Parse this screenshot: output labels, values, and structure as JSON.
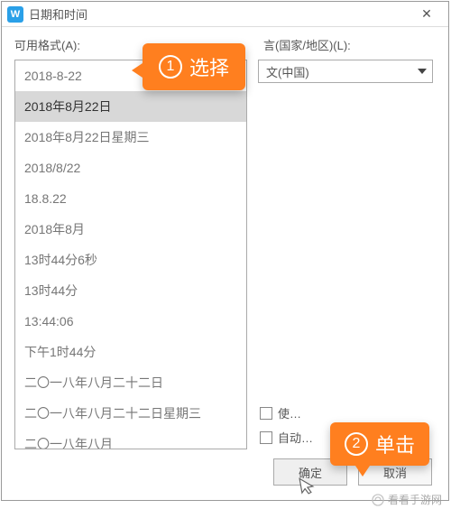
{
  "titlebar": {
    "icon_letter": "W",
    "title": "日期和时间",
    "close": "✕"
  },
  "labels": {
    "format": "可用格式(A):",
    "locale": "言(国家/地区)(L):"
  },
  "locale": {
    "selected": "文(中国)"
  },
  "formats": [
    "2018-8-22",
    "2018年8月22日",
    "2018年8月22日星期三",
    "2018/8/22",
    "18.8.22",
    "2018年8月",
    "13时44分6秒",
    "13时44分",
    "13:44:06",
    "下午1时44分",
    "二〇一八年八月二十二日",
    "二〇一八年八月二十二日星期三",
    "二〇一八年八月"
  ],
  "selected_index": 1,
  "checkboxes": {
    "use": "使…",
    "auto": "自动…"
  },
  "buttons": {
    "ok": "确定",
    "cancel": "取消"
  },
  "callouts": {
    "one_num": "1",
    "one_text": "选择",
    "two_num": "2",
    "two_text": "单击"
  },
  "watermark": "看看手游网"
}
